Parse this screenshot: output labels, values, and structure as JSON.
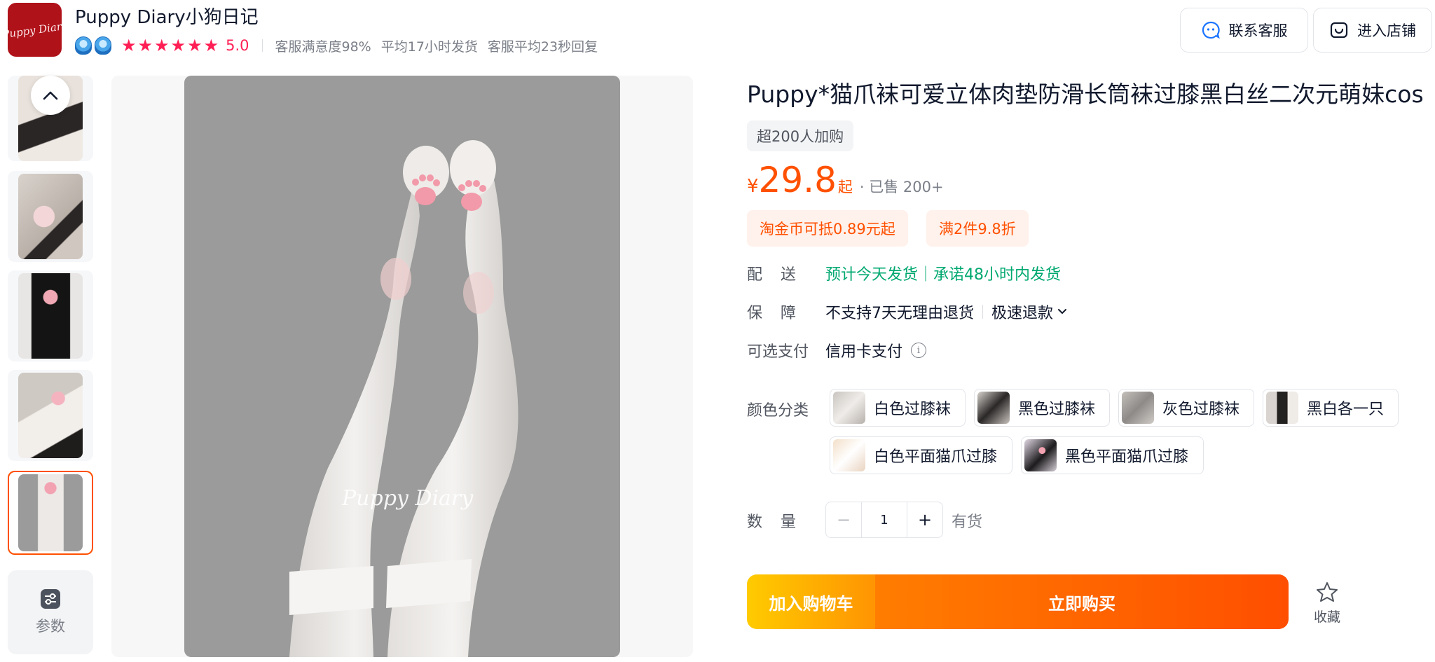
{
  "store": {
    "logo_text": "Puppy Diary",
    "name": "Puppy Diary小狗日记",
    "stars": [
      "★",
      "★",
      "★",
      "★",
      "★",
      "★"
    ],
    "rating": "5.0",
    "stats": [
      "客服满意度98%",
      "平均17小时发货",
      "客服平均23秒回复"
    ]
  },
  "header_actions": {
    "service": "联系客服",
    "store": "进入店铺"
  },
  "gallery": {
    "params_label": "参数",
    "watermark": "Puppy Diary",
    "thumbnails": [
      "thumb-1",
      "thumb-2",
      "thumb-3",
      "thumb-4",
      "thumb-5"
    ],
    "selected_index": 4
  },
  "product": {
    "title": "Puppy*猫爪袜可爱立体肉垫防滑长筒袜过膝黑白丝二次元萌妹cos",
    "buyers_tag": "超200人加购",
    "price_symbol": "¥",
    "price": "29.8",
    "price_suffix": "起",
    "sold": "· 已售 200+",
    "promos": [
      "淘金币可抵0.89元起",
      "满2件9.8折"
    ],
    "delivery": {
      "label": "配送",
      "value": "预计今天发货｜承诺48小时内发货"
    },
    "guarantee": {
      "label": "保障",
      "value": "不支持7天无理由退货",
      "extra": "极速退款"
    },
    "payment": {
      "label": "可选支付",
      "value": "信用卡支付"
    },
    "color": {
      "label": "颜色分类",
      "options": [
        "白色过膝袜",
        "黑色过膝袜",
        "灰色过膝袜",
        "黑白各一只",
        "白色平面猫爪过膝",
        "黑色平面猫爪过膝"
      ]
    },
    "quantity": {
      "label": "数量",
      "value": "1",
      "minus": "−",
      "plus": "+",
      "stock": "有货"
    },
    "add_to_cart": "加入购物车",
    "buy_now": "立即购买",
    "favorite": "收藏"
  },
  "colors": {
    "accent": "#ff5000",
    "star": "#ff1f55",
    "green": "#00a870",
    "store_logo_bg": "#b0121a"
  }
}
